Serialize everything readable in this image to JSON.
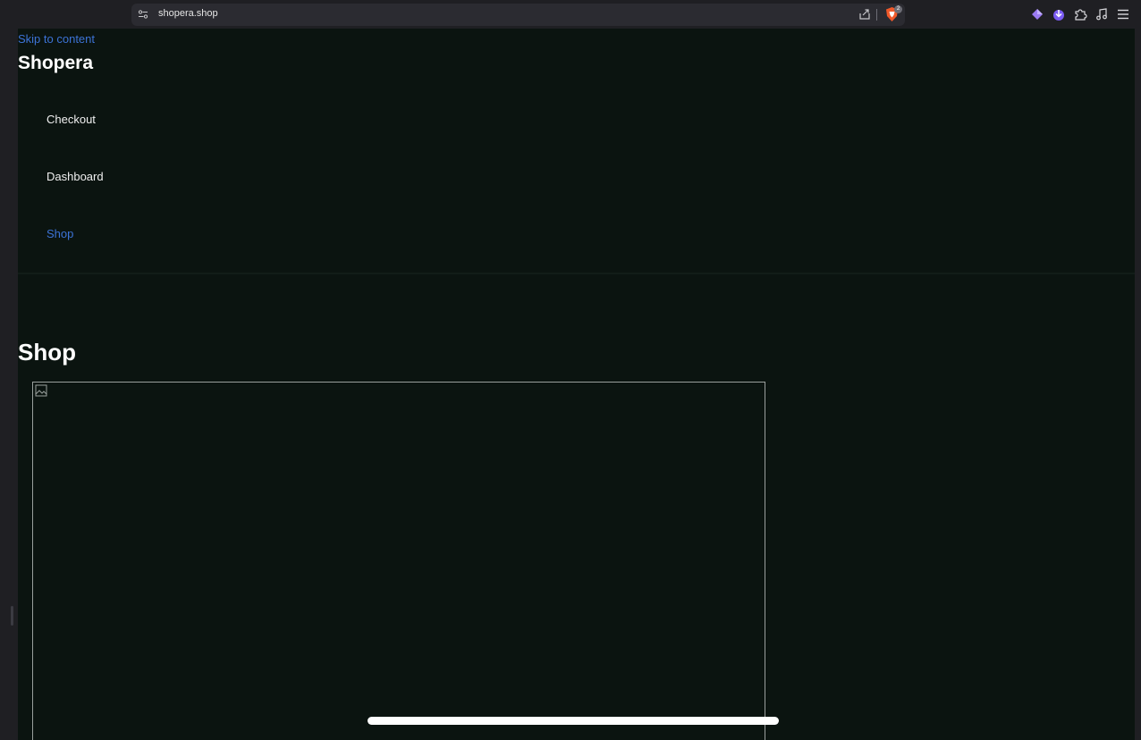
{
  "browser": {
    "url": "shopera.shop",
    "brave_shield_count": "2"
  },
  "page": {
    "skip_link": "Skip to content",
    "site_title": "Shopera",
    "nav": [
      {
        "label": "Checkout",
        "current": false
      },
      {
        "label": "Dashboard",
        "current": false
      },
      {
        "label": "Shop",
        "current": true
      }
    ],
    "heading": "Shop"
  },
  "colors": {
    "page_background": "#0b1410",
    "link": "#3c73d6",
    "browser_chrome": "#1f1f23"
  },
  "icons": [
    "site-settings-icon",
    "share-icon",
    "brave-shield-icon",
    "leo-ai-icon",
    "vpn-icon",
    "extensions-icon",
    "media-player-icon",
    "menu-icon",
    "broken-image-icon"
  ]
}
